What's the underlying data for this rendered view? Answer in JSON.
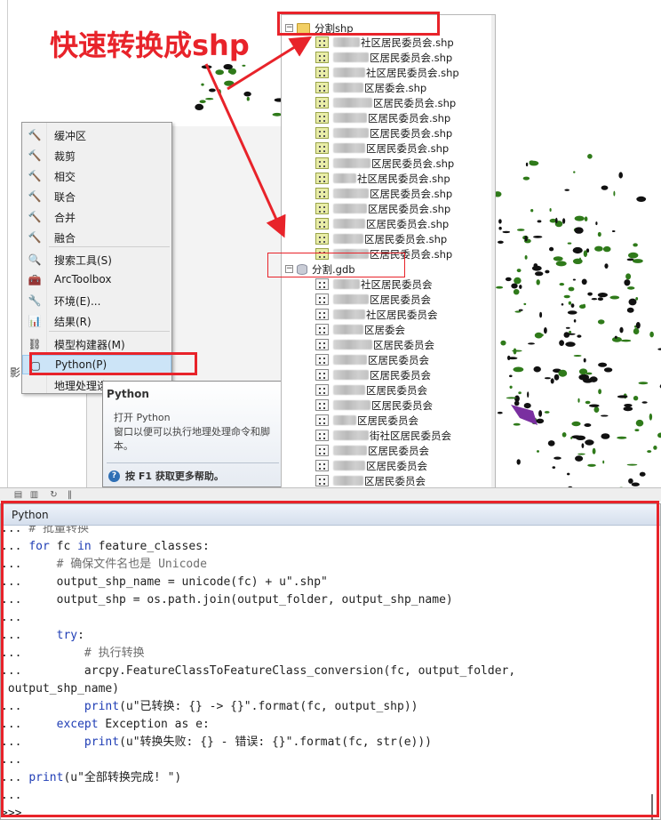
{
  "annotation": {
    "title": "快速转换成shp",
    "accent_color": "#e8232a"
  },
  "context_menu": {
    "items": [
      {
        "icon": "hammer-icon",
        "label": "缓冲区"
      },
      {
        "icon": "hammer-icon",
        "label": "裁剪"
      },
      {
        "icon": "hammer-icon",
        "label": "相交"
      },
      {
        "icon": "hammer-icon",
        "label": "联合"
      },
      {
        "icon": "hammer-icon",
        "label": "合并"
      },
      {
        "icon": "hammer-icon",
        "label": "融合"
      },
      {
        "icon": "search-window-icon",
        "label": "搜索工具(S)"
      },
      {
        "icon": "toolbox-icon",
        "label": "ArcToolbox"
      },
      {
        "icon": "wrench-icon",
        "label": "环境(E)..."
      },
      {
        "icon": "results-icon",
        "label": "结果(R)"
      },
      {
        "icon": "modelbuilder-icon",
        "label": "模型构建器(M)"
      },
      {
        "icon": "python-window-icon",
        "label": "Python(P)"
      },
      {
        "icon": "",
        "label": "地理处理选"
      }
    ],
    "left_cut_label": "影"
  },
  "tooltip": {
    "title": "Python",
    "description": "打开 Python\n窗口以便可以执行地理处理命令和脚本。",
    "help_text": "按 F1 获取更多帮助。"
  },
  "catalog": {
    "folder_label": "分割shp",
    "shp_items": [
      "社区居民委员会.shp",
      "区居民委员会.shp",
      "社区居民委员会.shp",
      "区居委会.shp",
      "区居民委员会.shp",
      "区居民委员会.shp",
      "区居民委员会.shp",
      "区居民委员会.shp",
      "区居民委员会.shp",
      "社区居民委员会.shp",
      "区居民委员会.shp",
      "区居民委员会.shp",
      "区居民委员会.shp",
      "区居民委员会.shp",
      "区居民委员会.shp"
    ],
    "gdb_label": "分割.gdb",
    "gdb_items": [
      "社区居民委员会",
      "区居民委员会",
      "社区居民委员会",
      "区居委会",
      "区居民委员会",
      "区居民委员会",
      "区居民委员会",
      "区居民委员会",
      "区居民委员会",
      "区居民委员会",
      "街社区居民委员会",
      "区居民委员会",
      "区居民委员会",
      "区居民委员会",
      "区居民委员会",
      "区居民委员会"
    ]
  },
  "python_window": {
    "title": "Python",
    "lines": [
      [
        {
          "t": "... ",
          "c": ""
        },
        {
          "t": "# 批量转换",
          "c": "cm"
        }
      ],
      [
        {
          "t": "... ",
          "c": ""
        },
        {
          "t": "for",
          "c": "kw"
        },
        {
          "t": " fc ",
          "c": ""
        },
        {
          "t": "in",
          "c": "kw"
        },
        {
          "t": " feature_classes:",
          "c": ""
        }
      ],
      [
        {
          "t": "...     ",
          "c": ""
        },
        {
          "t": "# 确保文件名也是 Unicode",
          "c": "cm"
        }
      ],
      [
        {
          "t": "...     output_shp_name = unicode(fc) + u\".shp\"",
          "c": ""
        }
      ],
      [
        {
          "t": "...     output_shp = os.path.join(output_folder, output_shp_name)",
          "c": ""
        }
      ],
      [
        {
          "t": "...",
          "c": ""
        }
      ],
      [
        {
          "t": "...     ",
          "c": ""
        },
        {
          "t": "try",
          "c": "kw"
        },
        {
          "t": ":",
          "c": ""
        }
      ],
      [
        {
          "t": "...         ",
          "c": ""
        },
        {
          "t": "# 执行转换",
          "c": "cm"
        }
      ],
      [
        {
          "t": "...         arcpy.FeatureClassToFeatureClass_conversion(fc, output_folder,",
          "c": ""
        }
      ],
      [
        {
          "t": " output_shp_name)",
          "c": ""
        }
      ],
      [
        {
          "t": "...         ",
          "c": ""
        },
        {
          "t": "print",
          "c": "kw"
        },
        {
          "t": "(u\"已转换: {} -> {}\".format(fc, output_shp))",
          "c": ""
        }
      ],
      [
        {
          "t": "...     ",
          "c": ""
        },
        {
          "t": "except",
          "c": "kw"
        },
        {
          "t": " Exception as e:",
          "c": ""
        }
      ],
      [
        {
          "t": "...         ",
          "c": ""
        },
        {
          "t": "print",
          "c": "kw"
        },
        {
          "t": "(u\"转换失败: {} - 错误: {}\".format(fc, str(e)))",
          "c": ""
        }
      ],
      [
        {
          "t": "...",
          "c": ""
        }
      ],
      [
        {
          "t": "... ",
          "c": ""
        },
        {
          "t": "print",
          "c": "kw"
        },
        {
          "t": "(u\"全部转换完成! \")",
          "c": ""
        }
      ],
      [
        {
          "t": "...",
          "c": ""
        }
      ],
      [
        {
          "t": ">>>",
          "c": ""
        }
      ]
    ]
  }
}
